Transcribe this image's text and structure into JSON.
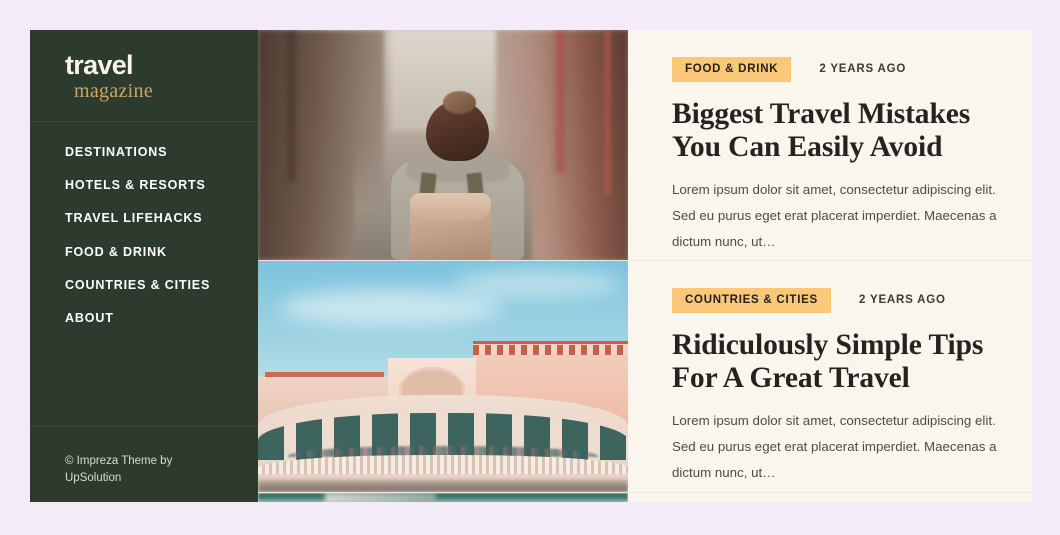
{
  "theme": {
    "page_background": "#f3ebf8",
    "sidebar_background": "#2c3b2d",
    "content_background": "#faf6ee",
    "badge_background": "#fbc87a",
    "brand_accent": "#cfa65e"
  },
  "sidebar": {
    "brand": {
      "line1": "travel",
      "line2": "magazine"
    },
    "nav": [
      {
        "label": "Destinations"
      },
      {
        "label": "Hotels & Resorts"
      },
      {
        "label": "Travel Lifehacks"
      },
      {
        "label": "Food & Drink"
      },
      {
        "label": "Countries & Cities"
      },
      {
        "label": "About"
      }
    ],
    "footer": {
      "credit": "© Impreza Theme by UpSolution"
    }
  },
  "content": {
    "posts": [
      {
        "category": "Food & Drink",
        "date": "2 years ago",
        "title": "Biggest Travel Mistakes You Can Easily Avoid",
        "excerpt": "Lorem ipsum dolor sit amet, consectetur adipiscing elit. Sed eu purus eget erat placerat imperdiet. Maecenas a dictum nunc, ut…",
        "image_alt": "woman with backpack walking down narrow alley"
      },
      {
        "category": "Countries & Cities",
        "date": "2 years ago",
        "title": "Ridiculously Simple Tips For A Great Travel",
        "excerpt": "Lorem ipsum dolor sit amet, consectetur adipiscing elit. Sed eu purus eget erat placerat imperdiet. Maecenas a dictum nunc, ut…",
        "image_alt": "rialto bridge venice at sunset"
      },
      {
        "image_alt": "partially visible next post image"
      }
    ]
  }
}
